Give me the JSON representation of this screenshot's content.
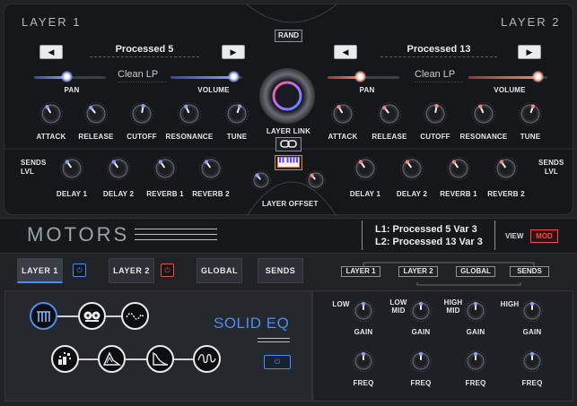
{
  "layers": {
    "left": {
      "header": "LAYER 1",
      "prev_arrow": "◀",
      "next_arrow": "▶",
      "preset": "Processed 5",
      "filter": "Clean LP",
      "pan_label": "PAN",
      "volume_label": "VOLUME",
      "pan_value": 0.45,
      "volume_value": 0.88,
      "knobs": [
        "ATTACK",
        "RELEASE",
        "CUTOFF",
        "RESONANCE",
        "TUNE"
      ],
      "sends_label": "SENDS\nLVL",
      "sends": [
        "DELAY 1",
        "DELAY 2",
        "REVERB 1",
        "REVERB 2"
      ],
      "accent": "#8c9cf0"
    },
    "right": {
      "header": "LAYER 2",
      "prev_arrow": "◀",
      "next_arrow": "▶",
      "preset": "Processed 13",
      "filter": "Clean LP",
      "pan_label": "PAN",
      "volume_label": "VOLUME",
      "pan_value": 0.45,
      "volume_value": 0.88,
      "knobs": [
        "ATTACK",
        "RELEASE",
        "CUTOFF",
        "RESONANCE",
        "TUNE"
      ],
      "sends_label": "SENDS\nLVL",
      "sends": [
        "DELAY 1",
        "DELAY 2",
        "REVERB 1",
        "REVERB 2"
      ],
      "accent": "#f0847a"
    }
  },
  "center": {
    "rand_label": "RAND",
    "layer_link_label": "LAYER LINK",
    "layer_offset_label": "LAYER OFFSET",
    "link_icon": "chain-link-icon",
    "keyboard_icon": "keyboard-icon"
  },
  "motors": {
    "title": "MOTORS",
    "line1": "L1: Processed 5 Var 3",
    "line2": "L2: Processed 13 Var 3",
    "view_label": "VIEW",
    "mod_label": "MOD"
  },
  "tabs": {
    "layer1": "LAYER 1",
    "layer2": "LAYER 2",
    "global": "GLOBAL",
    "sends": "SENDS",
    "nav_layer1": "LAYER 1",
    "nav_layer2": "LAYER 2",
    "nav_global": "GLOBAL",
    "nav_sends": "SENDS",
    "power_icon": "⏻"
  },
  "eq": {
    "title": "SOLID EQ",
    "bands": [
      {
        "name": "LOW",
        "gain": "GAIN",
        "freq": "FREQ"
      },
      {
        "name": "LOW\nMID",
        "gain": "GAIN",
        "freq": "FREQ"
      },
      {
        "name": "HIGH\nMID",
        "gain": "GAIN",
        "freq": "FREQ"
      },
      {
        "name": "HIGH",
        "gain": "GAIN",
        "freq": "FREQ"
      }
    ],
    "power_icon": "⏻"
  },
  "colors": {
    "blue_accent": "#4c8ef0",
    "red_accent": "#e05050",
    "mod_red": "#ff4a3a"
  }
}
